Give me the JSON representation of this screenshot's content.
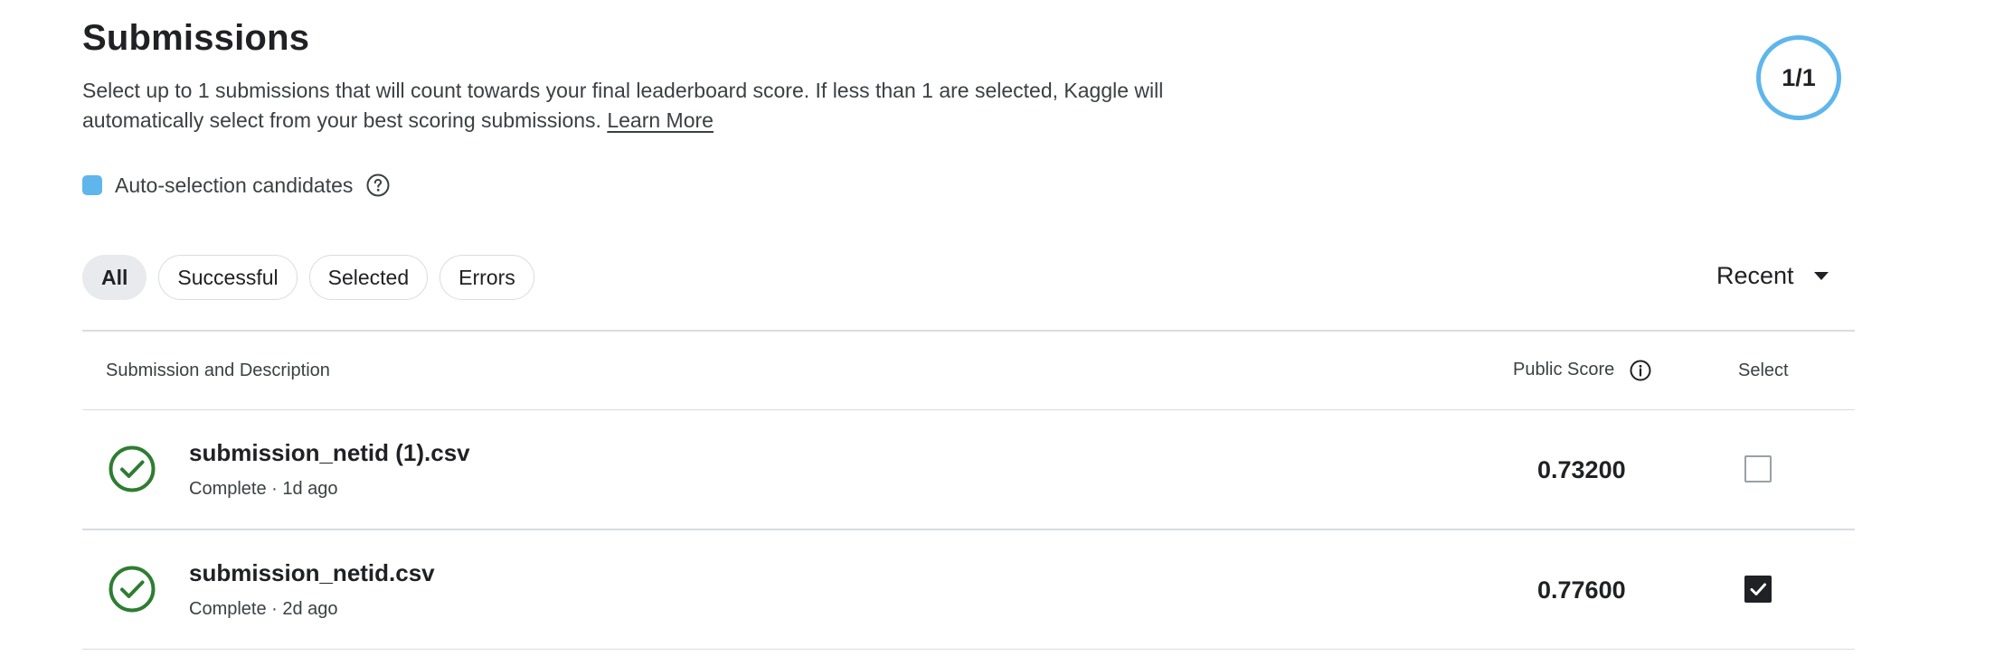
{
  "header": {
    "title": "Submissions",
    "description": "Select up to 1 submissions that will count towards your final leaderboard score. If less than 1 are selected, Kaggle will automatically select from your best scoring submissions.",
    "learn_more": "Learn More",
    "selection_counter": "1/1",
    "accent_color": "#5eb6ec"
  },
  "auto_selection": {
    "label": "Auto-selection candidates",
    "icon": "help-circle-icon"
  },
  "filters": [
    {
      "label": "All",
      "active": true
    },
    {
      "label": "Successful",
      "active": false
    },
    {
      "label": "Selected",
      "active": false
    },
    {
      "label": "Errors",
      "active": false
    }
  ],
  "sort": {
    "label": "Recent",
    "icon": "caret-down-icon"
  },
  "table": {
    "columns": {
      "submission": "Submission and Description",
      "score": "Public Score",
      "select": "Select"
    },
    "rows": [
      {
        "name": "submission_netid (1).csv",
        "meta": "Complete · 1d ago",
        "score": "0.73200",
        "selected": false,
        "status_icon": "check-circle-icon"
      },
      {
        "name": "submission_netid.csv",
        "meta": "Complete · 2d ago",
        "score": "0.77600",
        "selected": true,
        "status_icon": "check-circle-icon"
      }
    ],
    "success_color": "#2e7d32"
  }
}
